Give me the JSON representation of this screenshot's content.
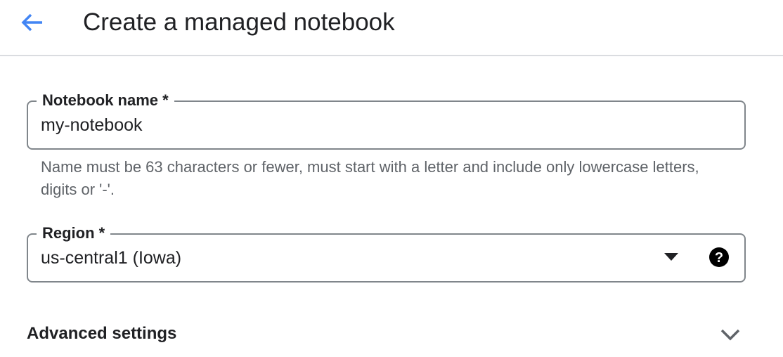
{
  "header": {
    "back_icon": "arrow-back-icon",
    "title": "Create a managed notebook"
  },
  "form": {
    "notebook_name": {
      "label": "Notebook name *",
      "value": "my-notebook",
      "helper": "Name must be 63 characters or fewer, must start with a letter and include only lowercase letters, digits or '-'."
    },
    "region": {
      "label": "Region *",
      "value": "us-central1 (Iowa)",
      "dropdown_icon": "arrow-drop-down-icon",
      "help_icon": "help-icon"
    },
    "advanced": {
      "label": "Advanced settings",
      "expand_icon": "chevron-down-icon"
    }
  },
  "colors": {
    "accent": "#4285f4",
    "text": "#202124",
    "secondary_text": "#5f6368",
    "border": "#80868b",
    "divider": "#dadce0"
  }
}
